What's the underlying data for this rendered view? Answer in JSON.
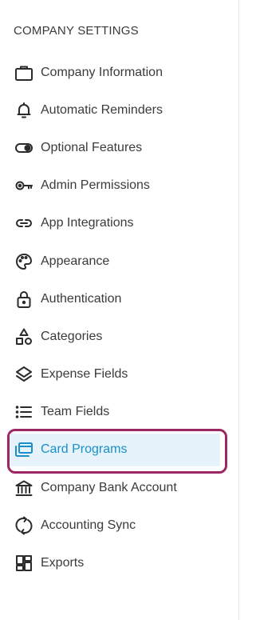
{
  "section": {
    "title": "COMPANY SETTINGS"
  },
  "menu": [
    {
      "label": "Company Information",
      "icon": "briefcase-icon"
    },
    {
      "label": "Automatic Reminders",
      "icon": "bell-icon"
    },
    {
      "label": "Optional Features",
      "icon": "toggle-icon"
    },
    {
      "label": "Admin Permissions",
      "icon": "key-icon"
    },
    {
      "label": "App Integrations",
      "icon": "link-icon"
    },
    {
      "label": "Appearance",
      "icon": "palette-icon"
    },
    {
      "label": "Authentication",
      "icon": "lock-icon"
    },
    {
      "label": "Categories",
      "icon": "shapes-icon"
    },
    {
      "label": "Expense Fields",
      "icon": "layers-icon"
    },
    {
      "label": "Team Fields",
      "icon": "list-icon"
    },
    {
      "label": "Card Programs",
      "icon": "cards-icon",
      "active": true
    },
    {
      "label": "Company Bank Account",
      "icon": "bank-icon"
    },
    {
      "label": "Accounting Sync",
      "icon": "sync-icon"
    },
    {
      "label": "Exports",
      "icon": "dashboard-icon"
    }
  ],
  "colors": {
    "active_text": "#1a8fc9",
    "active_bg": "#e6f3fa",
    "highlight_border": "#9c2763"
  }
}
